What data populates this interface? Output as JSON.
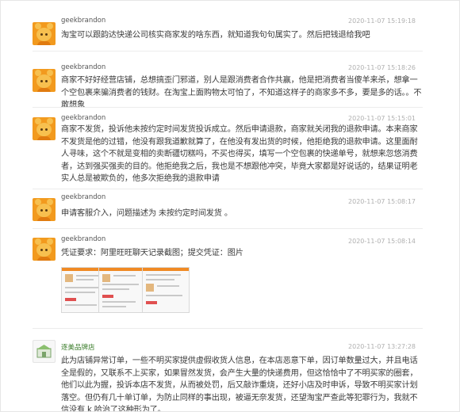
{
  "messages": [
    {
      "user": "geekbrandon",
      "time": "2020-11-07 15:19:18",
      "text": "淘宝可以跟韵达快递公司核实商家发的啥东西，就知道我句句属实了。然后把钱退给我吧"
    },
    {
      "user": "geekbrandon",
      "time": "2020-11-07 15:18:26",
      "text": "商家不好好经营店铺，总想搞歪门邪道，别人是跟消费者合作共赢，他是把消费者当傻羊来杀，想拿一个空包裹来骗消费者的钱财。在淘宝上面购物太可怕了，不知道这样子的商家多不多，要是多的话。。不敢想象"
    },
    {
      "user": "geekbrandon",
      "time": "2020-11-07 15:15:01",
      "text": "商家不发货，投诉他未按约定时间发货投诉成立。然后申请退款，商家就关闭我的退款申请。本来商家不发货是他的过错，他没有跟我道歉就算了，在他没有发出货的时候，他拒绝我的退款申请。这里面耐人寻味，这个不就是变相的卖断疆切糕吗，不买也得买，填写一个空包裹的快递单号，就想来忽悠消费者，达到强买强卖的目的。他拒绝我之后，我也是不想跟他冲突，毕竟大家都是好说话的，结果证明老实人总是被欺负的，他多次拒绝我的退款申请"
    },
    {
      "user": "geekbrandon",
      "time": "2020-11-07 15:08:17",
      "text": "申请客服介入，问题描述为 未按约定时间发货 。"
    },
    {
      "user": "geekbrandon",
      "time": "2020-11-07 15:08:14",
      "text": "凭证要求：阿里旺旺聊天记录截图；提交凭证：图片"
    },
    {
      "user": "逐美品牌店",
      "time": "2020-11-07 13:27:28",
      "text": "此为店铺异常订单，一些不明买家提供虚假收货人信息，在本店恶意下单，因订单数量过大，并且电话全是假的，又联系不上买家，如果冒然发货，会产生大量的快递费用，但这恰恰中了不明买家的圈套，他们以此为握，投诉本店不发货，从而被处罚，后又敲诈重烧，还好小店及时申诉，导致不明买家计划落空。但仍有几十单订单，为防止同样的事出现，被逼无奈发货，还望淘宝严查此等犯罪行为，我就不信没有 k 哈治了这种形为了。"
    }
  ],
  "icons": {
    "user_avatar": "fox-avatar-icon",
    "shop_avatar": "shop-logo-icon",
    "evidence": "screenshot-thumbnail"
  },
  "colors": {
    "avatar_orange": "#f29a1e",
    "shop_name_green": "#3a7c2a",
    "timestamp_gray": "#b0b0b0"
  }
}
